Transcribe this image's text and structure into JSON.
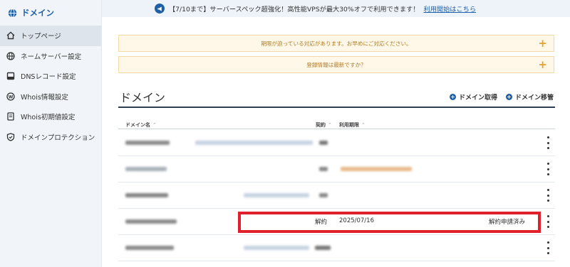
{
  "sidebar": {
    "title": "ドメイン",
    "items": [
      {
        "label": "トップページ",
        "icon": "home-icon"
      },
      {
        "label": "ネームサーバー設定",
        "icon": "globe-icon"
      },
      {
        "label": "DNSレコード設定",
        "icon": "server-icon"
      },
      {
        "label": "Whois情報設定",
        "icon": "whois-icon"
      },
      {
        "label": "Whois初期値設定",
        "icon": "document-icon"
      },
      {
        "label": "ドメインプロテクション",
        "icon": "shield-icon"
      }
    ]
  },
  "banner": {
    "text": "【7/10まで】サーバースペック超強化！高性能VPSが最大30%オフで利用できます！",
    "link": "利用開始はこちら",
    "icon": "megaphone-icon"
  },
  "alerts": [
    {
      "text": "期限が迫っている対応があります。お早めにご対応ください。",
      "expand": "+"
    },
    {
      "text": "登録情報は最新ですか？",
      "expand": "+"
    }
  ],
  "domains": {
    "title": "ドメイン",
    "actions": [
      {
        "label": "ドメイン取得",
        "icon": "plus-circle-icon"
      },
      {
        "label": "ドメイン移管",
        "icon": "plus-circle-icon"
      }
    ],
    "columns": [
      "ドメイン名",
      "契約",
      "利用期限"
    ],
    "sort_glyph": "⌃",
    "highlighted_row": {
      "contract": "解約",
      "expiry": "2025/07/16",
      "status": "解約申請済み"
    }
  },
  "colors": {
    "accent": "#1f5fa8",
    "alert_bg": "#fff8e8",
    "alert_text": "#b07a22",
    "highlight": "#e0202b"
  }
}
